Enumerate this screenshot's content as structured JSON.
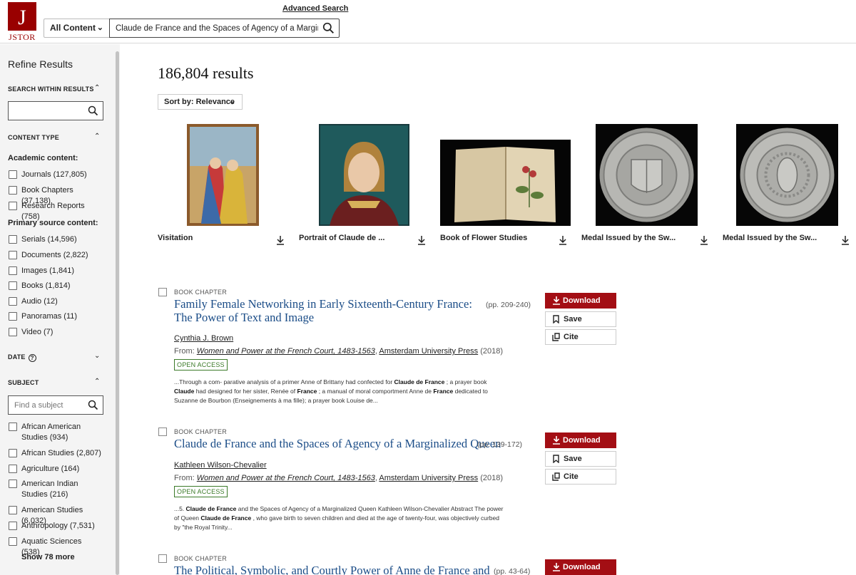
{
  "header": {
    "logo_text": "JSTOR",
    "logo_glyph": "J",
    "content_filter": "All Content",
    "search_value": "Claude de France and the Spaces of Agency of a Marginalized Queen",
    "advanced_search": "Advanced Search"
  },
  "sidebar": {
    "title": "Refine Results",
    "search_within": "SEARCH WITHIN RESULTS",
    "content_type": "CONTENT TYPE",
    "academic_label": "Academic content:",
    "academic": [
      {
        "label": "Journals (127,805)"
      },
      {
        "label": "Book Chapters (37,138)"
      },
      {
        "label": "Research Reports (758)"
      }
    ],
    "primary_label": "Primary source content:",
    "primary": [
      {
        "label": "Serials (14,596)"
      },
      {
        "label": "Documents (2,822)"
      },
      {
        "label": "Images (1,841)"
      },
      {
        "label": "Books (1,814)"
      },
      {
        "label": "Audio (12)"
      },
      {
        "label": "Panoramas (11)"
      },
      {
        "label": "Video (7)"
      }
    ],
    "date": "DATE",
    "subject": "SUBJECT",
    "subject_placeholder": "Find a subject",
    "subjects": [
      {
        "label": "African American Studies (934)"
      },
      {
        "label": "African Studies (2,807)"
      },
      {
        "label": "Agriculture (164)"
      },
      {
        "label": "American Indian Studies (216)"
      },
      {
        "label": "American Studies (6,032)"
      },
      {
        "label": "Anthropology (7,531)"
      },
      {
        "label": "Aquatic Sciences (538)"
      }
    ],
    "show_more": "Show 78 more"
  },
  "main": {
    "results_count": "186,804 results",
    "sort_label": "Sort by: Relevance",
    "images": [
      {
        "title": "Visitation"
      },
      {
        "title": "Portrait of Claude de ..."
      },
      {
        "title": "Book of Flower Studies"
      },
      {
        "title": "Medal Issued by the Sw..."
      },
      {
        "title": "Medal Issued by the Sw..."
      }
    ],
    "results": [
      {
        "type": "BOOK CHAPTER",
        "title": "Family Female Networking in Early Sixteenth-Century France: The Power of Text and Image",
        "pages": "(pp. 209-240)",
        "author": "Cynthia J. Brown",
        "from": "From:",
        "book": "Women and Power at the French Court, 1483-1563",
        "publisher": "Amsterdam University Press",
        "year": "(2018)",
        "badge": "OPEN ACCESS",
        "snippet": [
          {
            "t": "...Through a com- parative analysis of a primer Anne of Brittany had confected for ",
            "b": false
          },
          {
            "t": "Claude de France",
            "b": true
          },
          {
            "t": " ; a prayer book ",
            "b": false
          },
          {
            "t": "Claude",
            "b": true
          },
          {
            "t": " had designed for her sister, Renée of ",
            "b": false
          },
          {
            "t": "France",
            "b": true
          },
          {
            "t": " ; a manual of moral comportment Anne de ",
            "b": false
          },
          {
            "t": "France",
            "b": true
          },
          {
            "t": " dedicated to Suzanne de Bourbon (Enseignements à ma fille); a prayer book Louise de...",
            "b": false
          }
        ]
      },
      {
        "type": "BOOK CHAPTER",
        "title": "Claude de France and the Spaces of Agency of a Marginalized Queen",
        "pages": "(pp. 139-172)",
        "author": "Kathleen Wilson-Chevalier",
        "from": "From:",
        "book": "Women and Power at the French Court, 1483-1563",
        "publisher": "Amsterdam University Press",
        "year": "(2018)",
        "badge": "OPEN ACCESS",
        "snippet": [
          {
            "t": "...5. ",
            "b": false
          },
          {
            "t": "Claude de France",
            "b": true
          },
          {
            "t": " and the Spaces of Agency of a Marginalized Queen Kathleen Wilson-Chevalier Abstract The power of Queen ",
            "b": false
          },
          {
            "t": "Claude de France",
            "b": true
          },
          {
            "t": " , who gave birth to seven children and died at the age of twenty-four, was objectively curbed by \"the Royal Trinity...",
            "b": false
          }
        ]
      },
      {
        "type": "BOOK CHAPTER",
        "title": "The Political, Symbolic, and Courtly Power of Anne de France and",
        "pages": "(pp. 43-64)"
      }
    ],
    "buttons": {
      "download": "Download",
      "save": "Save",
      "cite": "Cite"
    }
  }
}
